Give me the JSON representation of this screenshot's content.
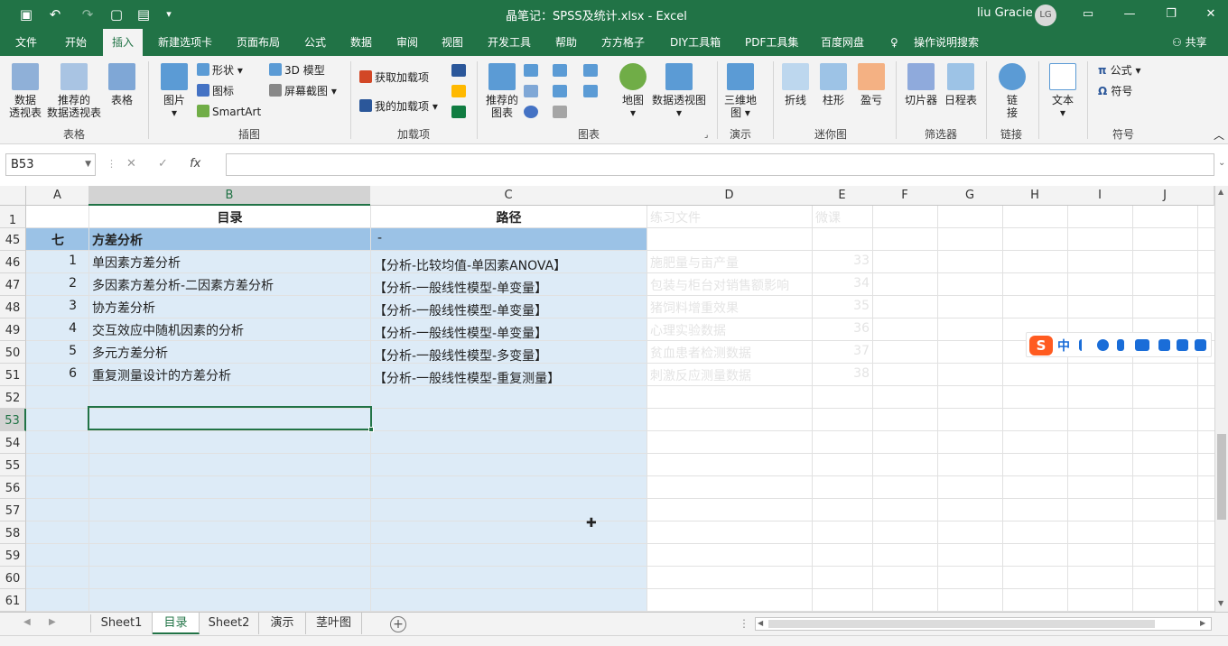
{
  "titlebar": {
    "title": "晶笔记：SPSS及统计.xlsx  -  Excel",
    "user": "liu Gracie",
    "avatar": "LG",
    "qa_icons": [
      "save-icon",
      "undo-icon",
      "redo-icon",
      "new-icon",
      "form-icon",
      "customize-icon"
    ]
  },
  "ribbon_tabs": [
    "文件",
    "开始",
    "插入",
    "新建选项卡",
    "页面布局",
    "公式",
    "数据",
    "审阅",
    "视图",
    "开发工具",
    "帮助",
    "方方格子",
    "DIY工具箱",
    "PDF工具集",
    "百度网盘",
    "操作说明搜索"
  ],
  "active_tab": "插入",
  "share": "共享",
  "ribbon": {
    "groups": {
      "table": "表格",
      "illustration": "插图",
      "addins": "加载项",
      "charts": "图表",
      "tour": "演示",
      "sparkline": "迷你图",
      "filter": "筛选器",
      "link": "链接",
      "symbol": "符号"
    },
    "buttons": {
      "pivot_l1": "数据",
      "pivot_l2": "透视表",
      "rec_pivot_l1": "推荐的",
      "rec_pivot_l2": "数据透视表",
      "table": "表格",
      "picture": "图片",
      "shape": "形状",
      "icon": "图标",
      "model3d": "3D 模型",
      "smartart": "SmartArt",
      "screenshot": "屏幕截图",
      "get_addins": "获取加载项",
      "my_addins": "我的加载项",
      "rec_chart_l1": "推荐的",
      "rec_chart_l2": "图表",
      "map": "地图",
      "pivot_chart": "数据透视图",
      "map3d_l1": "三维地",
      "map3d_l2": "图",
      "line": "折线",
      "column": "柱形",
      "winloss": "盈亏",
      "slicer": "切片器",
      "timeline": "日程表",
      "link_l1": "链",
      "link_l2": "接",
      "text": "文本",
      "equation": "公式",
      "symbol": "符号"
    }
  },
  "formula_bar": {
    "name_box": "B53",
    "cancel": "✕",
    "enter": "✓",
    "fx": "fx",
    "value": ""
  },
  "columns": [
    "A",
    "B",
    "C",
    "D",
    "E",
    "F",
    "G",
    "H",
    "I",
    "J"
  ],
  "selected_column": "B",
  "rows": [
    "1",
    "45",
    "46",
    "47",
    "48",
    "49",
    "50",
    "51",
    "52",
    "53",
    "54",
    "55",
    "56",
    "57",
    "58",
    "59",
    "60",
    "61"
  ],
  "selected_row": "53",
  "header_row": {
    "b": "目录",
    "c": "路径",
    "d": "练习文件",
    "e": "微课"
  },
  "section": {
    "a": "七",
    "b": "方差分析",
    "c": "-"
  },
  "items": [
    {
      "num": "1",
      "name": "单因素方差分析",
      "path": "【分析-比较均值-单因素ANOVA】",
      "file": "施肥量与亩产量",
      "lesson": "33"
    },
    {
      "num": "2",
      "name": "多因素方差分析-二因素方差分析",
      "path": "【分析-一般线性模型-单变量】",
      "file": "包装与柜台对销售额影响",
      "lesson": "34"
    },
    {
      "num": "3",
      "name": "协方差分析",
      "path": "【分析-一般线性模型-单变量】",
      "file": "猪饲料增重效果",
      "lesson": "35"
    },
    {
      "num": "4",
      "name": "交互效应中随机因素的分析",
      "path": "【分析-一般线性模型-单变量】",
      "file": "心理实验数据",
      "lesson": "36"
    },
    {
      "num": "5",
      "name": "多元方差分析",
      "path": "【分析-一般线性模型-多变量】",
      "file": "贫血患者检测数据",
      "lesson": "37"
    },
    {
      "num": "6",
      "name": "重复测量设计的方差分析",
      "path": "【分析-一般线性模型-重复测量】",
      "file": "刺激反应测量数据",
      "lesson": "38"
    }
  ],
  "sheets": [
    "Sheet1",
    "目录",
    "Sheet2",
    "演示",
    "茎叶图"
  ],
  "active_sheet": "目录",
  "ime": {
    "logo": "S",
    "mode": "中"
  },
  "colors": {
    "excel_green": "#217346",
    "band_blue": "#9bc2e6",
    "light_blue": "#ddebf7"
  }
}
